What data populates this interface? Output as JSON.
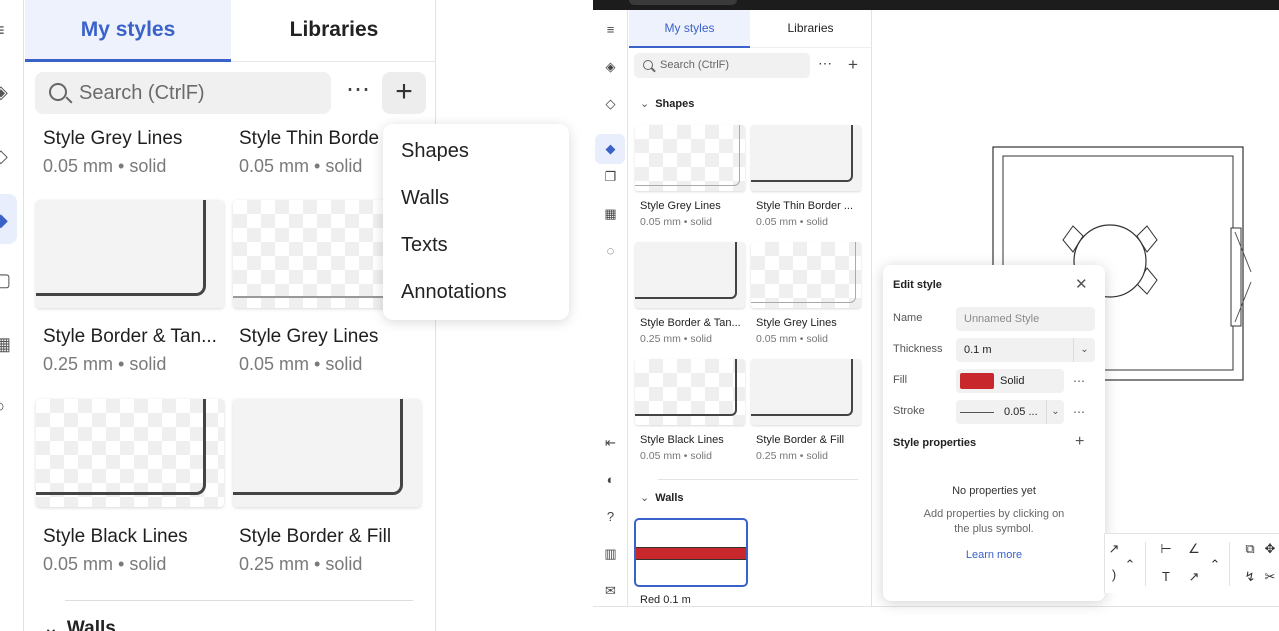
{
  "zoom": {
    "tabs": {
      "my_styles": "My styles",
      "libraries": "Libraries"
    },
    "search_placeholder": "Search (CtrlF)",
    "more_label": "⋯",
    "add_label": "+",
    "cards": [
      {
        "title": "Style Grey Lines",
        "sub": "0.05 mm • solid"
      },
      {
        "title": "Style Thin Borde",
        "sub": "0.05 mm • solid"
      },
      {
        "title": "Style Border & Tan...",
        "sub": "0.25 mm • solid"
      },
      {
        "title": "Style Grey Lines",
        "sub": "0.05 mm • solid"
      },
      {
        "title": "Style Black Lines",
        "sub": "0.05 mm • solid"
      },
      {
        "title": "Style Border & Fill",
        "sub": "0.25 mm • solid"
      }
    ],
    "menu": [
      "Shapes",
      "Walls",
      "Texts",
      "Annotations"
    ],
    "walls_label": "Walls"
  },
  "app": {
    "tabs": {
      "my_styles": "My styles",
      "libraries": "Libraries"
    },
    "search_placeholder": "Search (CtrlF)",
    "more_label": "⋯",
    "add_label": "+",
    "sections": {
      "shapes": "Shapes",
      "walls": "Walls"
    },
    "cards": [
      {
        "title": "Style Grey Lines",
        "sub": "0.05 mm • solid"
      },
      {
        "title": "Style Thin Border ...",
        "sub": "0.05 mm • solid"
      },
      {
        "title": "Style Border & Tan...",
        "sub": "0.25 mm • solid"
      },
      {
        "title": "Style Grey Lines",
        "sub": "0.05 mm • solid"
      },
      {
        "title": "Style Black Lines",
        "sub": "0.05 mm • solid"
      },
      {
        "title": "Style Border & Fill",
        "sub": "0.25 mm • solid"
      }
    ],
    "wall_label": "Red 0.1 m",
    "edit_style": {
      "title": "Edit style",
      "name_label": "Name",
      "name_placeholder": "Unnamed Style",
      "thickness_label": "Thickness",
      "thickness_value": "0.1 m",
      "fill_label": "Fill",
      "fill_value": "Solid",
      "fill_color": "#c8272c",
      "stroke_label": "Stroke",
      "stroke_value": "0.05 ...",
      "properties_label": "Style properties",
      "no_props_title": "No properties yet",
      "no_props_desc": "Add properties by clicking on the plus symbol.",
      "learn_more": "Learn more"
    },
    "accent_color": "#3a62c9"
  }
}
